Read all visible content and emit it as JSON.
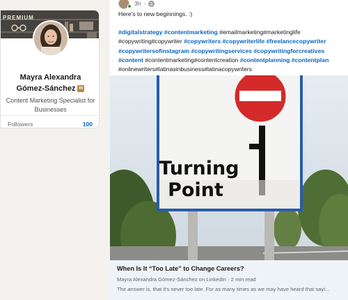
{
  "profile": {
    "premium_label": "PREMIUM",
    "name_line1": "Mayra Alexandra",
    "name_line2": "Gómez-Sánchez",
    "badge": "in",
    "headline": "Content Marketing Specialist for Businesses",
    "followers_label": "Followers",
    "followers_count": "100"
  },
  "post": {
    "time": "3h",
    "intro": "Here's to new beginnings. :)",
    "hashtag_segments": [
      {
        "text": "#digitalstrategy",
        "link": true
      },
      {
        "text": " ",
        "link": false
      },
      {
        "text": "#contentmarketing",
        "link": true
      },
      {
        "text": " #emailmarketing#marketinglife #copywriting#copywriter ",
        "link": false
      },
      {
        "text": "#copywriters",
        "link": true
      },
      {
        "text": " ",
        "link": false
      },
      {
        "text": "#copywriterlife",
        "link": true
      },
      {
        "text": " ",
        "link": false
      },
      {
        "text": "#freelancecopywriter",
        "link": true
      },
      {
        "text": " ",
        "link": false
      },
      {
        "text": "#copywritersofinstagram",
        "link": true
      },
      {
        "text": " ",
        "link": false
      },
      {
        "text": "#copywritingservices",
        "link": true
      },
      {
        "text": " ",
        "link": false
      },
      {
        "text": "#copywritingforcreatives",
        "link": true
      },
      {
        "text": " ",
        "link": false
      },
      {
        "text": "#content",
        "link": true
      },
      {
        "text": " #contentmarketing#contentcreation ",
        "link": false
      },
      {
        "text": "#contentplanning",
        "link": true
      },
      {
        "text": " ",
        "link": false
      },
      {
        "text": "#contentplan",
        "link": true
      },
      {
        "text": " #onlinewriters#latinasinbusiness#latinacopywriters",
        "link": false
      }
    ],
    "article": {
      "sign_line1": "Turning",
      "sign_line2": "Point",
      "title": "When Is It “Too Late” to Change Careers?",
      "source": "Mayra Alexandra Gómez-Sánchez on LinkedIn · 2 min read",
      "snippet": "The answer is, that it's never too late. For as many times as we may have heard that sayi..."
    }
  },
  "colors": {
    "link_blue": "#0a66c2",
    "sign_border": "#2a5ca8",
    "no_entry_red": "#d42a2a"
  },
  "icons": [
    "globe-icon",
    "premium-icon",
    "linkedin-badge-icon"
  ]
}
